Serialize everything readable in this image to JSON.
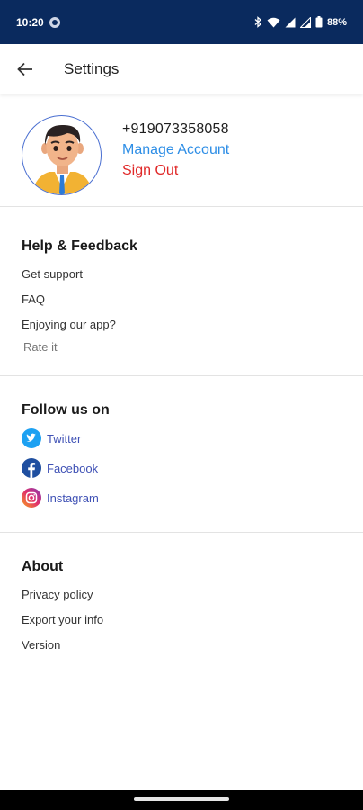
{
  "status_bar": {
    "time": "10:20",
    "battery": "88%",
    "icons": [
      "notification-dot-icon",
      "bluetooth-icon",
      "wifi-icon",
      "signal-icon",
      "signal-icon",
      "battery-icon"
    ]
  },
  "app_bar": {
    "title": "Settings",
    "back_icon": "arrow-left-icon"
  },
  "profile": {
    "phone": "+919073358058",
    "manage_account": "Manage Account",
    "sign_out": "Sign Out"
  },
  "help": {
    "heading": "Help & Feedback",
    "items": [
      "Get support",
      "FAQ",
      "Enjoying our app?"
    ],
    "rate": "Rate it"
  },
  "follow": {
    "heading": "Follow us on",
    "links": [
      {
        "label": "Twitter",
        "icon": "twitter-icon",
        "color": "#1da1f2"
      },
      {
        "label": "Facebook",
        "icon": "facebook-icon",
        "color": "#1877f2"
      },
      {
        "label": "Instagram",
        "icon": "instagram-icon",
        "color": "#e1306c"
      }
    ]
  },
  "about": {
    "heading": "About",
    "items": [
      "Privacy policy",
      "Export your info",
      "Version"
    ]
  },
  "colors": {
    "status_bar": "#0a2a5e",
    "link_blue": "#2e8ee6",
    "sign_out_red": "#e02828",
    "social_label": "#3f51b5"
  }
}
